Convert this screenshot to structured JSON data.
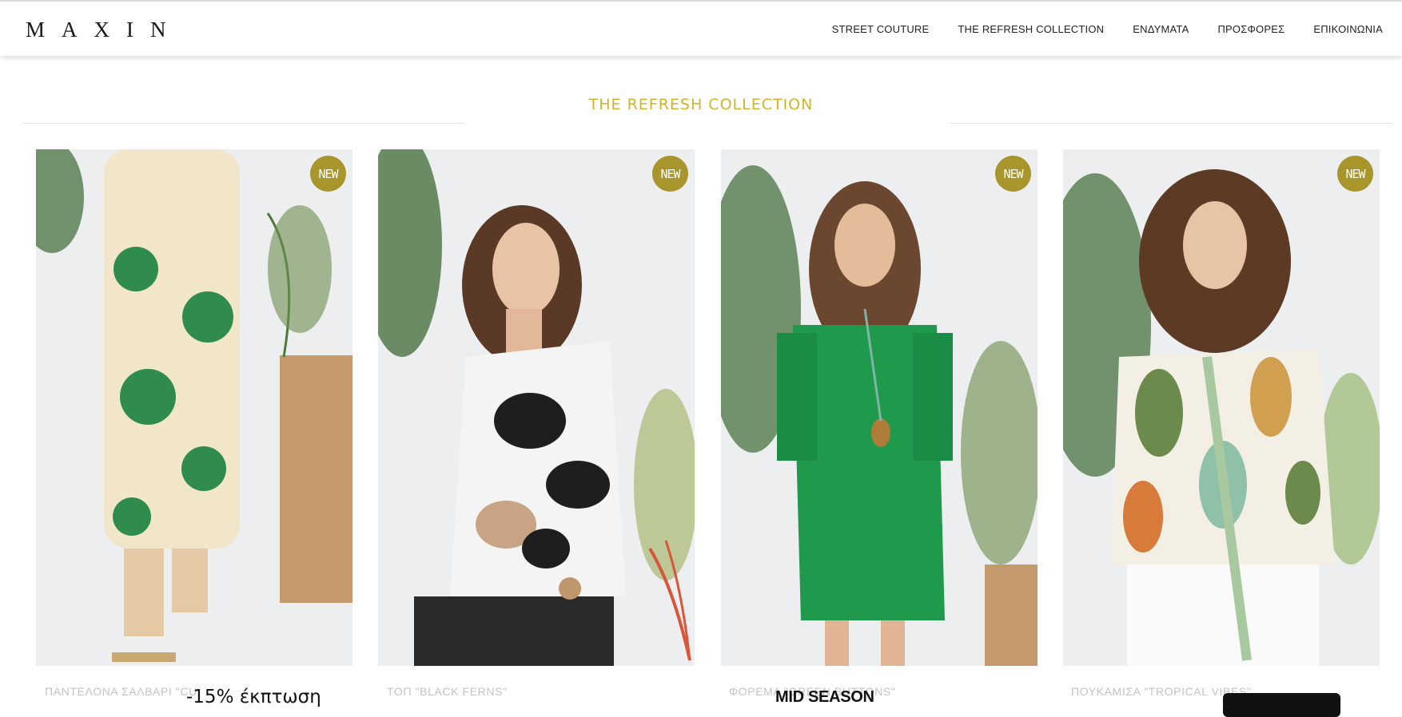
{
  "brand": {
    "logo_text": "MAXIN"
  },
  "nav": {
    "items": [
      {
        "label": "STREET COUTURE"
      },
      {
        "label": "THE REFRESH COLLECTION"
      },
      {
        "label": "ΕΝΔΥΜΑΤΑ"
      },
      {
        "label": "ΠΡΟΣΦΟΡΕΣ"
      },
      {
        "label": "ΕΠΙΚΟΙΝΩΝΙΑ"
      }
    ]
  },
  "section": {
    "title": "THE REFRESH COLLECTION"
  },
  "colors": {
    "accent_gold": "#d4b22a",
    "badge_olive": "#a8962c",
    "product_name_grey": "#c3c3c3"
  },
  "products": [
    {
      "badge": "NEW",
      "name": "ΠΑΝΤΕΛΟΝΑ ΣΑΛΒΑΡΙ \"CU",
      "image": "model-floral-green-trousers"
    },
    {
      "badge": "NEW",
      "name": "ΤΟΠ \"BLACK FERNS\"",
      "image": "model-black-white-floral-top"
    },
    {
      "badge": "NEW",
      "name": "ΦΟΡΕΜΑ \"GREEN BUTTONS\"",
      "image": "model-green-shirt-dress"
    },
    {
      "badge": "NEW",
      "name": "ΠΟΥΚΑΜΙΣΑ \"TROPICAL VIBES\"",
      "image": "model-tropical-print-shirt"
    }
  ],
  "promo": {
    "discount_text": "-15% έκπτωση",
    "campaign_text": "MID SEASON"
  }
}
